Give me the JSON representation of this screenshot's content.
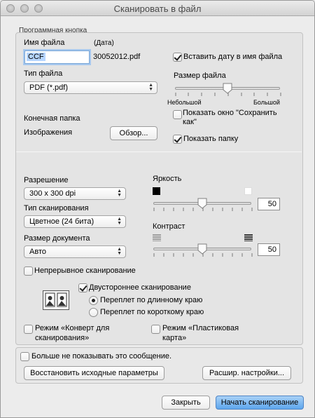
{
  "window": {
    "title": "Сканировать в файл"
  },
  "program_button_group": {
    "label": "Программная кнопка",
    "file_name": {
      "label": "Имя файла",
      "date_hint": "(Дата)",
      "value": "CCF",
      "suffix": "30052012.pdf"
    },
    "insert_date": {
      "label": "Вставить дату в имя файла",
      "checked": true
    },
    "file_type": {
      "label": "Тип файла",
      "value": "PDF (*.pdf)"
    },
    "file_size": {
      "label": "Размер файла",
      "min_label": "Небольшой",
      "max_label": "Большой",
      "level": 0.5
    },
    "destination": {
      "label": "Конечная папка",
      "folder": "Изображения",
      "browse_label": "Обзор..."
    },
    "show_save_as": {
      "label": "Показать окно \"Сохранить как\"",
      "checked": false
    },
    "show_folder": {
      "label": "Показать папку",
      "checked": true
    }
  },
  "scan_settings": {
    "resolution": {
      "label": "Разрешение",
      "value": "300 x 300  dpi"
    },
    "scan_type": {
      "label": "Тип сканирования",
      "value": "Цветное (24 бита)"
    },
    "document_size": {
      "label": "Размер документа",
      "value": "Авто"
    },
    "brightness": {
      "label": "Яркость",
      "value": "50",
      "level": 0.5
    },
    "contrast": {
      "label": "Контраст",
      "value": "50",
      "level": 0.5
    },
    "continuous_scan": {
      "label": "Непрерывное сканирование",
      "checked": false
    },
    "duplex": {
      "label": "Двустороннее сканирование",
      "checked": true
    },
    "long_edge": {
      "label": "Переплет по длинному краю",
      "selected": true
    },
    "short_edge": {
      "label": "Переплет по короткому краю",
      "selected": false
    },
    "envelope_mode": {
      "label_line1": "Режим «Конверт для",
      "label_line2": "сканирования»",
      "checked": false
    },
    "plastic_card_mode": {
      "label_line1": "Режим «Пластиковая",
      "label_line2": "карта»",
      "checked": false
    }
  },
  "footer_group": {
    "dont_show": {
      "label": "Больше не показывать это сообщение.",
      "checked": false
    },
    "restore_defaults_label": "Восстановить исходные параметры",
    "advanced_settings_label": "Расшир. настройки..."
  },
  "dialog_buttons": {
    "close_label": "Закрыть",
    "start_scan_label": "Начать сканирование"
  }
}
